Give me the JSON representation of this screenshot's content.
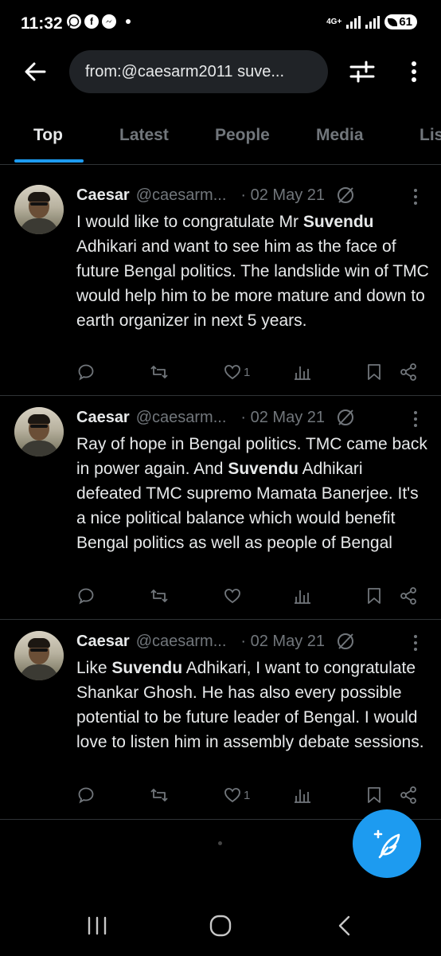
{
  "status_bar": {
    "time": "11:32",
    "network": "4G+",
    "battery": "61",
    "notification_icons": [
      "whatsapp-icon",
      "facebook-icon",
      "messenger-icon",
      "dot-icon"
    ]
  },
  "header": {
    "search_query": "from:@caesarm2011 suve..."
  },
  "tabs": [
    {
      "label": "Top",
      "active": true
    },
    {
      "label": "Latest",
      "active": false
    },
    {
      "label": "People",
      "active": false
    },
    {
      "label": "Media",
      "active": false
    },
    {
      "label": "Lis",
      "active": false
    }
  ],
  "tweets": [
    {
      "name": "Caesar",
      "handle": "@caesarm...",
      "date": "· 02 May 21",
      "text_parts": [
        "I would like to congratulate Mr ",
        "Suvendu",
        " Adhikari and want to see him as the face of future Bengal politics. The landslide win of TMC would help him to be more mature and down to earth organizer in next 5 years."
      ],
      "likes": "1"
    },
    {
      "name": "Caesar",
      "handle": "@caesarm...",
      "date": "· 02 May 21",
      "text_parts": [
        "Ray of hope in Bengal politics. TMC came back in power again. And ",
        "Suvendu",
        " Adhikari defeated TMC supremo Mamata Banerjee. It's a nice political balance which would benefit Bengal politics as well as people of Bengal"
      ],
      "likes": ""
    },
    {
      "name": "Caesar",
      "handle": "@caesarm...",
      "date": "· 02 May 21",
      "text_parts": [
        "Like ",
        "Suvendu",
        " Adhikari, I want to congratulate Shankar Ghosh. He has also every possible potential to be future leader of Bengal. I would love to listen him in assembly debate sessions."
      ],
      "likes": "1"
    }
  ],
  "colors": {
    "background": "#000000",
    "accent": "#1d9bf0",
    "text_primary": "#e7e9ea",
    "text_secondary": "#71767b",
    "divider": "#2f3336"
  }
}
